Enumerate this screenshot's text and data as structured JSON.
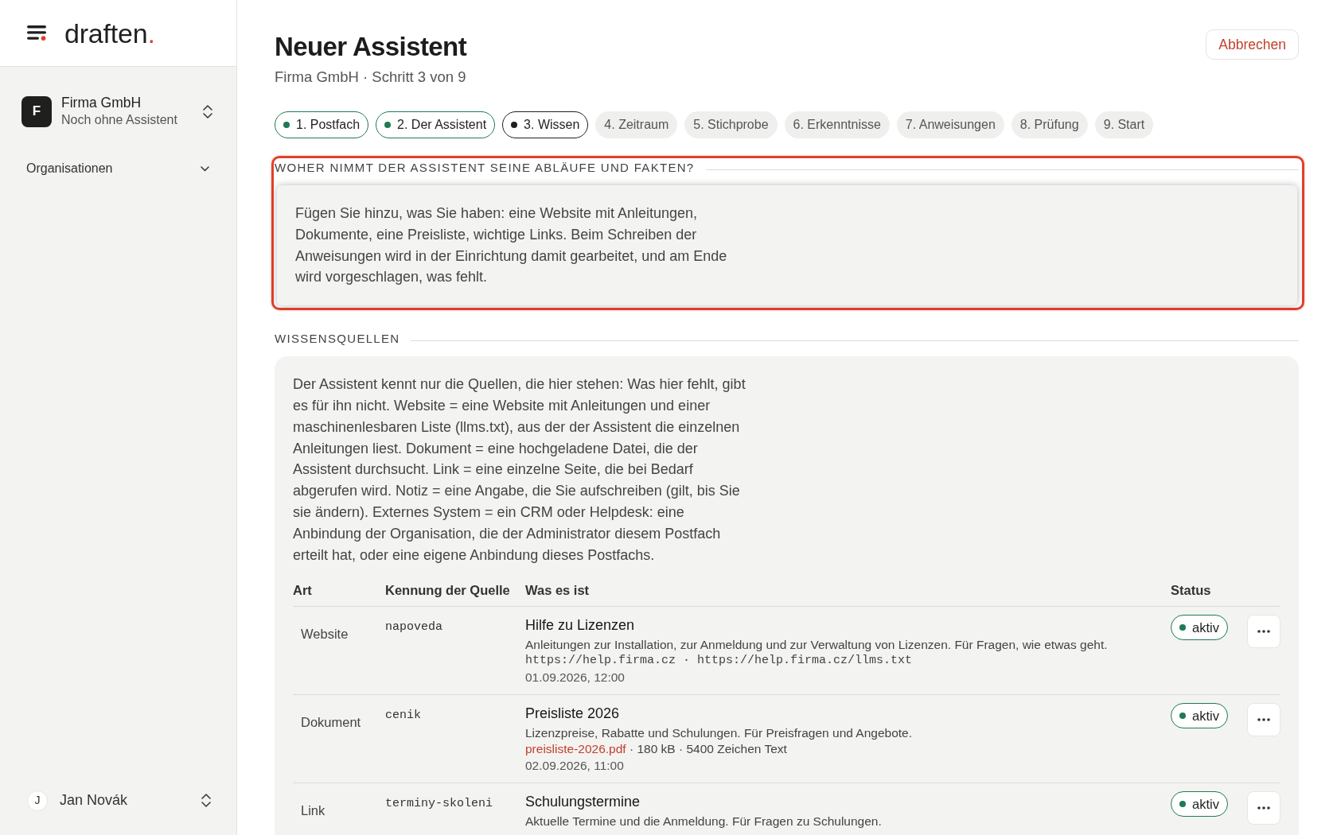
{
  "sidebar": {
    "logo": {
      "word": "draften",
      "dot": "."
    },
    "workspace": {
      "initial": "F",
      "name": "Firma GmbH",
      "subtitle": "Noch ohne Assistent"
    },
    "nav": [
      {
        "label": "Organisationen",
        "expanded": false
      }
    ],
    "user": {
      "initial": "J",
      "name": "Jan Novák"
    }
  },
  "header": {
    "title": "Neuer Assistent",
    "subtitle": "Firma GmbH · Schritt 3 von 9",
    "cancel_button": "Abbrechen"
  },
  "steps": [
    {
      "label": "1. Postfach",
      "completed": true,
      "selected": false
    },
    {
      "label": "2. Der Assistent",
      "completed": true,
      "selected": false
    },
    {
      "label": "3. Wissen",
      "completed": false,
      "selected": true
    },
    {
      "label": "4. Zeitraum",
      "completed": false,
      "selected": false
    },
    {
      "label": "5. Stichprobe",
      "completed": false,
      "selected": false
    },
    {
      "label": "6. Erkenntnisse",
      "completed": false,
      "selected": false
    },
    {
      "label": "7. Anweisungen",
      "completed": false,
      "selected": false
    },
    {
      "label": "8. Prüfung",
      "completed": false,
      "selected": false
    },
    {
      "label": "9. Start",
      "completed": false,
      "selected": false
    }
  ],
  "sections": [
    {
      "heading": "WOHER NIMMT DER ASSISTENT SEINE ABLÄUFE UND FAKTEN?",
      "highlighted": true,
      "text": "Fügen Sie hinzu, was Sie haben: eine Website mit Anleitungen, Dokumente, eine Preisliste, wichtige Links. Beim Schreiben der Anweisungen wird in der Einrichtung damit gearbeitet, und am Ende wird vorgeschlagen, was fehlt."
    },
    {
      "heading": "WISSENSQUELLEN",
      "highlighted": false,
      "text": "Der Assistent kennt nur die Quellen, die hier stehen: Was hier fehlt, gibt es für ihn nicht. Website = eine Website mit Anleitungen und einer maschinenlesbaren Liste (llms.txt), aus der der Assistent die einzelnen Anleitungen liest. Dokument = eine hochgeladene Datei, die der Assistent durchsucht. Link = eine einzelne Seite, die bei Bedarf abgerufen wird. Notiz = eine Angabe, die Sie aufschreiben (gilt, bis Sie sie ändern). Externes System = ein CRM oder Helpdesk: eine Anbindung der Organisation, die der Administrator diesem Postfach erteilt hat, oder eine eigene Anbindung dieses Postfachs.",
      "table": {
        "columns": [
          "Art",
          "Kennung der Quelle",
          "Was es ist",
          "Status"
        ],
        "rows": [
          {
            "type": "Website",
            "source_id": "napoveda",
            "title": "Hilfe zu Lizenzen",
            "description": "Anleitungen zur Installation, zur Anmeldung und zur Verwaltung von Lizenzen. Für Fragen, wie etwas geht.",
            "urls": "https://help.firma.cz · https://help.firma.cz/llms.txt",
            "date": "01.09.2026, 12:00",
            "status": "aktiv"
          },
          {
            "type": "Dokument",
            "source_id": "cenik",
            "title": "Preisliste 2026",
            "description": "Lizenzpreise, Rabatte und Schulungen. Für Preisfragen und Angebote.",
            "file": "preisliste-2026.pdf",
            "file_info": "· 180 kB · 5400 Zeichen Text",
            "date": "02.09.2026, 11:00",
            "status": "aktiv"
          },
          {
            "type": "Link",
            "source_id": "terminy-skoleni",
            "title": "Schulungstermine",
            "description": "Aktuelle Termine und die Anmeldung. Für Fragen zu Schulungen.",
            "status": "aktiv"
          }
        ]
      }
    }
  ]
}
